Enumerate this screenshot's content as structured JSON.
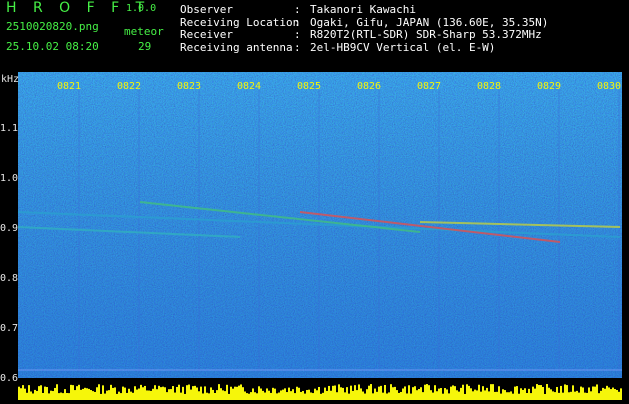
{
  "header": {
    "app_name": "H R O F F T",
    "app_version": "1.0.0",
    "file_name": "2510020820.png",
    "date_time": "25.10.02 08:20",
    "meteor_label": "meteor",
    "meteor_count": "29"
  },
  "station_info": [
    {
      "key": "Observer",
      "sep": ":",
      "value": "Takanori Kawachi"
    },
    {
      "key": "Receiving Location",
      "sep": ":",
      "value": "Ogaki, Gifu, JAPAN (136.60E, 35.35N)"
    },
    {
      "key": "Receiver",
      "sep": ":",
      "value": "R820T2(RTL-SDR) SDR-Sharp 53.372MHz"
    },
    {
      "key": "Receiving antenna",
      "sep": ":",
      "value": "2el-HB9CV Vertical (el. E-W)"
    }
  ],
  "axis": {
    "unit": "kHz",
    "y_labels": [
      "1.1",
      "1.0",
      "0.9",
      "0.8",
      "0.7",
      "0.6"
    ],
    "time_labels": [
      "0821",
      "0822",
      "0823",
      "0824",
      "0825",
      "0826",
      "0827",
      "0828",
      "0829",
      "0830"
    ]
  },
  "colors": {
    "background": "#000000",
    "title_green": "#46f046",
    "time_label": "#f6f60a",
    "level_bar": "#f6f60a",
    "spectrogram_base": "#0a1e8c"
  }
}
